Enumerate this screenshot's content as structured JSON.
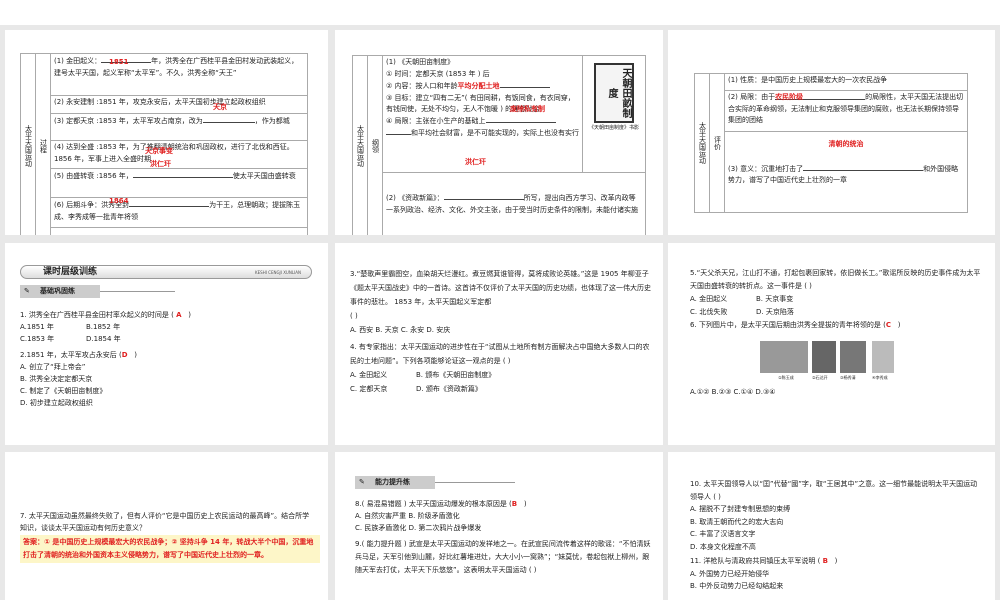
{
  "s1": {
    "c1": "太平天国运动",
    "c2": "过程",
    "r1": "(1) 金田起义：",
    "r1b": "年，洪秀全在广西桂平县金田村发动武装起义，建号太平天国，起义军称“太平军”。不久，洪秀全称“天王”",
    "a1": "1851",
    "r2": "(2) 永安建制 :1851 年，攻克永安后，太平天国初步建立起政权组织",
    "a2": "天京",
    "r3": "(3) 定都天京 :1853 年，太平军攻占南京，改为",
    "r3b": "，作为都城",
    "r4": "(4) 达到全盛 :1853 年，为了推翻清朝统治和巩固政权，进行了北伐和西征。 1856 年，军事上进入全盛时期",
    "a4": "天京事变",
    "a4b": "洪仁玕",
    "r5": "(5) 由盛转衰 :1856 年，",
    "r5b": "使太平天国由盛转衰",
    "a5": "1864",
    "r6": "(6) 后期斗争：洪秀全封",
    "r6b": "为干王，总理朝政；提拔陈玉成、李秀成等一批青年将领"
  },
  "s2": {
    "c1": "太平天国运动",
    "c2": "纲领",
    "t1": "(1) 《天朝田亩制度》",
    "t2": "① 时间：定都天京 (1853 年 ) 后",
    "t3": "② 内容：按人口和年龄",
    "a3": "平均分配土地",
    "t4": "③ 目标：建立“四有二无”( 有田同耕，有饭同食，有衣同穿，有钱同使，无处不均匀，无人不饱暖 ) 的理想社会",
    "a4": "废除私有制",
    "t5": "④ 局限：主张在小生产的基础上",
    "t5b": "和平均社会财富，是不可能实现的，实际上也没有实行",
    "a5": "洪仁玕",
    "cap": "《天朝田亩制度》书影",
    "book": "天朝田畝制度",
    "z1": "(2) 《资政新篇》：",
    "z1b": "所写，提出向西方学习、改革内政等一系列政治、经济、文化、外交主张，由于受当时历史条件的限制，未能付诸实施"
  },
  "s3": {
    "c1": "太平天国运动",
    "c2": "评价",
    "p1": "(1) 性质：是中国历史上规模最宏大的一次农民战争",
    "p2": "(2) 局限：由于",
    "a2": "农民阶级",
    "p2b": "的局限性，太平天国无法提出切合实际的革命纲领，无法制止和克服领导集团的腐败，也无法长期保持领导集团的团结",
    "a3": "清朝的统治",
    "p3": "(3) 意义：沉重地打击了",
    "p3b": "和外国侵略势力，谱写了中国近代史上壮烈的一章"
  },
  "s4": {
    "banner": "课时层级训练",
    "banner_en": "KESHI CENGJI XUNLIAN",
    "section": "基础巩固练",
    "q1": "1. 洪秀全在广西桂平县金田村率众起义的时间是 (",
    "q1a": "A",
    "close": ")",
    "q1o": [
      "A.1851 年",
      "B.1852 年",
      "C.1853 年",
      "D.1854 年"
    ],
    "q2": "2.1851 年，太平军攻占永安后 (",
    "q2a": "D",
    "q2o": [
      "A. 创立了“拜上帝会”",
      "B. 洪秀全决定定都天京",
      "C. 制定了《天朝田亩制度》",
      "D. 初步建立起政权组织"
    ]
  },
  "s5": {
    "q3": "3.“楚歌声里霸图空，血染胡天烂漫红。煮豆燃萁谁管得，莫将成败论英雄。”这是 1905 年柳亚子《题太平天国战史》中的一首诗。这首诗不仅评价了太平天国的历史功绩，也体现了这一伟大历史事件的悲壮。 1853 年，太平天国起义军定都",
    "q3p": "(        )",
    "q3o": "A. 西安   B. 天京   C. 永安   D. 安庆",
    "q4": "4. 有专家指出：太平天国运动的进步性在于“试图从土地所有制方面解决占中国绝大多数人口的农民的土地问题”。下列各项能够论证这一观点的是 (        )",
    "q4o": [
      "A. 金田起义",
      "B. 颁布《天朝田亩制度》",
      "C. 定都天京",
      "D. 颁布《资政新篇》"
    ]
  },
  "s6": {
    "q5": "5.“天父杀天兄，江山打不通，打起包裹回家转，依旧做长工。”歌谣所反映的历史事件成为太平天国由盛转衰的转折点。这一事件是 (        )",
    "q5o": [
      "A. 金田起义",
      "B. 天京事变",
      "C. 北伐失败",
      "D. 天京陷落"
    ],
    "q6": "6. 下列图片中，是太平天国后期由洪秀全提拔的青年将领的是 (",
    "q6a": "C",
    "close": ")",
    "caps": [
      "①陈玉成",
      "②石达开",
      "③杨秀清",
      "④李秀成"
    ],
    "q6o": "A.①②   B.②③   C.①④   D.③④"
  },
  "s7": {
    "q7": "7. 太平天国运动虽然最终失败了，但有人评价“它是中国历史上农民运动的最高峰”。结合所学知识，谈谈太平天国运动有何历史意义？",
    "ans": "答案：① 是中国历史上规模最宏大的农民战争；② 坚持斗争 14 年，转战大半个中国，沉重地打击了清朝的统治和外国资本主义侵略势力，谱写了中国近代史上壮烈的一章。"
  },
  "s8": {
    "section": "能力提升练",
    "q8": "8.( 易混易错题 ) 太平天国运动爆发的根本原因是 (",
    "q8a": "B",
    "close": ")",
    "q8o": "A. 自然灾害严重   B. 阶级矛盾激化",
    "q8o2": "C. 民族矛盾激化   D. 第二次鸦片战争爆发",
    "q9": "9.( 能力提升题 ) 武宣是太平天国运动的发祥地之一。在武宣民间流传着这样的歌谣：“不怕清妖兵马足，天军引他到山麓，好比红薯堆进灶，大大小小一窝熟”；“妹莫忧，卷起包袱上柳州，跟随天军去打仗，太平天下乐悠悠”。这表明太平天国运动 (        )"
  },
  "s9": {
    "q10": "10. 太平天国领导人以“囯”代替“國”字，取“王居其中”之意。这一细节最能说明太平天国运动领导人 (        )",
    "q10o": [
      "A. 摆脱不了封建专制思想的束缚",
      "B. 取清王朝而代之的宏大志向",
      "C. 丰富了汉语言文字",
      "D. 本身文化程度不高"
    ],
    "q11": "11. 洋枪队与清政府共同镇压太平军说明 (",
    "q11a": "B",
    "close": ")",
    "q11o": [
      "A. 外国势力已经开始侵华",
      "B. 中外反动势力已经勾结起来"
    ]
  }
}
